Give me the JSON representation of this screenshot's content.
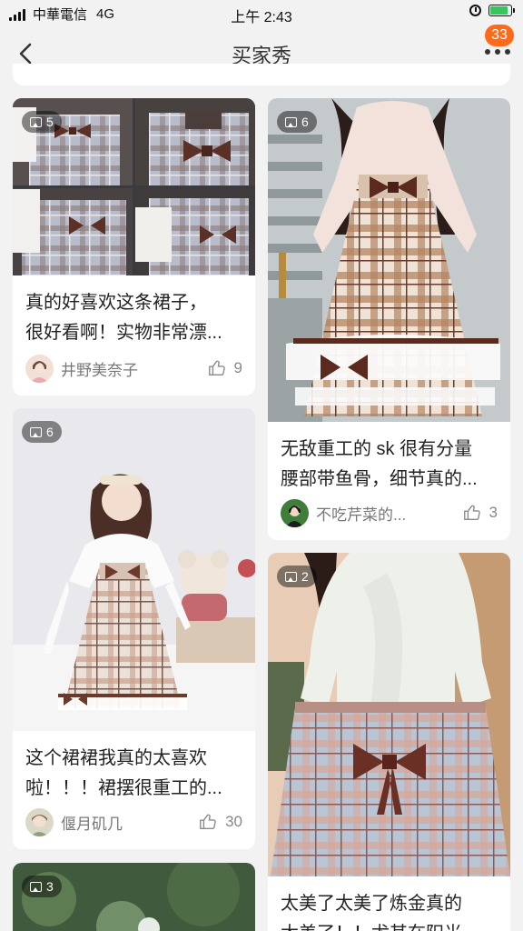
{
  "status_bar": {
    "carrier": "中華電信",
    "network": "4G",
    "time": "上午 2:43",
    "battery_color": "#35c759"
  },
  "navbar": {
    "back_icon": "chevron-left-icon",
    "title": "买家秀",
    "more_icon": "more-dots-icon",
    "badge": "33",
    "badge_color": "#ff6a1a"
  },
  "posts": [
    {
      "photo_count": "5",
      "lines": [
        "真的好喜欢这条裙子，",
        "很好看啊！实物非常漂..."
      ],
      "user": "井野美奈子",
      "likes": "9"
    },
    {
      "photo_count": "6",
      "lines": [
        "无敌重工的 sk 很有分量",
        "腰部带鱼骨，细节真的..."
      ],
      "user": "不吃芹菜的...",
      "likes": "3"
    },
    {
      "photo_count": "6",
      "lines": [
        "这个裙裙我真的太喜欢",
        "啦！！！裙摆很重工的..."
      ],
      "user": "偃月矶几",
      "likes": "30"
    },
    {
      "photo_count": "2",
      "lines": [
        "太美了太美了炼金真的",
        "太美了！！尤其在阳光"
      ],
      "user": "",
      "likes": ""
    },
    {
      "photo_count": "3",
      "lines": [],
      "user": "",
      "likes": ""
    }
  ]
}
